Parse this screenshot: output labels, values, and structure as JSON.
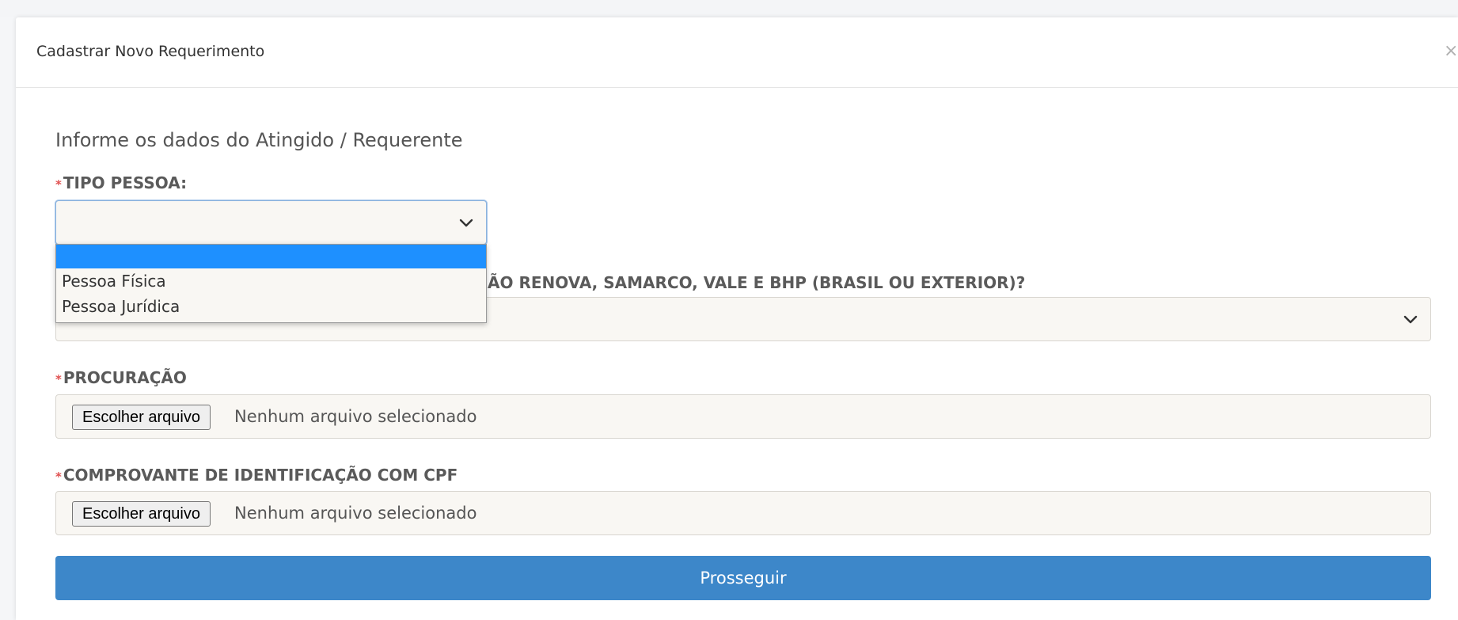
{
  "modal": {
    "title": "Cadastrar Novo Requerimento",
    "close_label": "×"
  },
  "form": {
    "intro": "Informe os dados do Atingido / Requerente",
    "tipo_pessoa": {
      "label": "TIPO PESSOA:",
      "selected_value": "",
      "options": [
        "",
        "Pessoa Física",
        "Pessoa Jurídica"
      ]
    },
    "question": {
      "label_visible": "ÃO RENOVA, SAMARCO, VALE E BHP (BRASIL OU EXTERIOR)?",
      "selected_value": ""
    },
    "procuracao": {
      "label": "PROCURAÇÃO",
      "button_label": "Escolher arquivo",
      "status": "Nenhum arquivo selecionado"
    },
    "comprovante": {
      "label": "COMPROVANTE DE IDENTIFICAÇÃO COM CPF",
      "button_label": "Escolher arquivo",
      "status": "Nenhum arquivo selecionado"
    },
    "required_marker": "*",
    "submit_label": "Prosseguir"
  },
  "colors": {
    "primary_button": "#3d87c9",
    "dropdown_highlight": "#1e90ff",
    "required": "#e05050"
  },
  "icons": {
    "select_chevron": "chevron-down-icon",
    "close": "close-icon"
  }
}
